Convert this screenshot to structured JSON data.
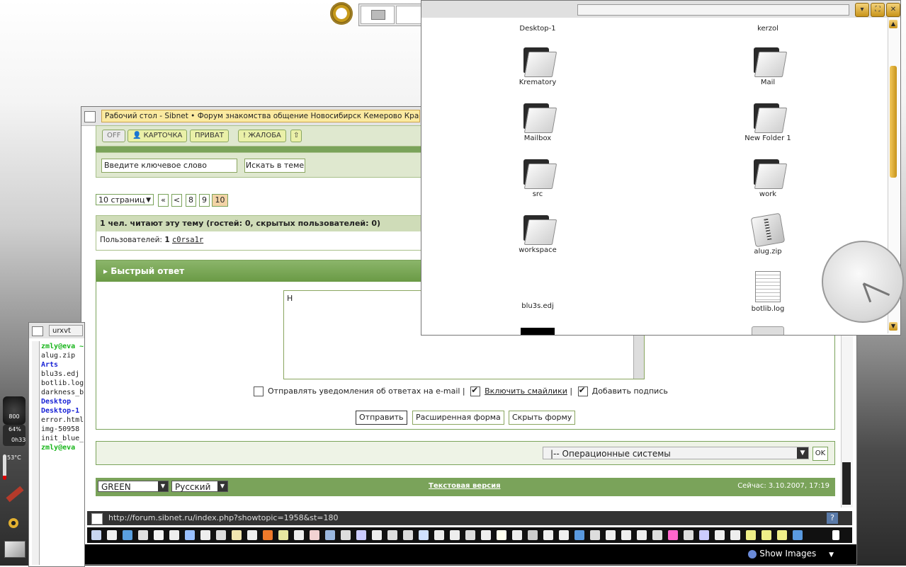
{
  "browser": {
    "title": "Рабочий стол - Sibnet • Форум знакомства общение Новосибирск Кемерово Красноярск",
    "url": "http://forum.sibnet.ru/index.php?showtopic=1958&st=180",
    "status": {
      "show_images": "Show Images"
    }
  },
  "forum": {
    "top_actions": {
      "off": "OFF",
      "card": "КАРТОЧКА",
      "private": "ПРИВАТ",
      "complaint": "ЖАЛОБА"
    },
    "search": {
      "placeholder": "Введите ключевое слово",
      "button": "Искать в теме"
    },
    "pagination": {
      "pages_label": "10 страниц",
      "first": "«",
      "prev": "<",
      "p8": "8",
      "p9": "9",
      "current": "10"
    },
    "readers": {
      "summary": "1 чел. читают эту тему (гостей: 0, скрытых пользователей: 0)",
      "users_prefix": "Пользователей:",
      "users_count": "1",
      "user_name": "c0rsa1r"
    },
    "quick_reply": {
      "title": "Быстрый ответ",
      "text_value": "Н",
      "notify_label": "Отправлять уведомления об ответах на e-mail |",
      "smilies_label": "Включить смайлики",
      "smilies_sep": "|",
      "signature_label": "Добавить подпись",
      "notify_checked": false,
      "smilies_checked": true,
      "signature_checked": true,
      "send": "Отправить",
      "advanced": "Расширенная форма",
      "hide": "Скрыть форму"
    },
    "jump": {
      "selected": "|-- Операционные системы",
      "ok": "OK"
    },
    "footer": {
      "skin": "GREEN",
      "language": "Русский",
      "text_version": "Текстовая версия",
      "now": "Сейчас: 3.10.2007, 17:19"
    }
  },
  "file_manager": {
    "items": [
      {
        "name": "Desktop-1",
        "type": "folder"
      },
      {
        "name": "kerzol",
        "type": "folder"
      },
      {
        "name": "Krematory",
        "type": "folder"
      },
      {
        "name": "Mail",
        "type": "folder"
      },
      {
        "name": "Mailbox",
        "type": "folder"
      },
      {
        "name": "New Folder 1",
        "type": "folder"
      },
      {
        "name": "src",
        "type": "folder"
      },
      {
        "name": "work",
        "type": "folder"
      },
      {
        "name": "workspace",
        "type": "folder"
      },
      {
        "name": "alug.zip",
        "type": "zip"
      },
      {
        "name": "blu3s.edj",
        "type": "file"
      },
      {
        "name": "botlib.log",
        "type": "log"
      }
    ]
  },
  "terminal": {
    "title": "urxvt",
    "lines": [
      {
        "text": "zmly@eva ~",
        "style": "green"
      },
      {
        "text": "alug.zip",
        "style": "plain"
      },
      {
        "text": "Arts",
        "style": "blue"
      },
      {
        "text": "blu3s.edj",
        "style": "plain"
      },
      {
        "text": "botlib.log",
        "style": "plain"
      },
      {
        "text": "darkness_b",
        "style": "plain"
      },
      {
        "text": "Desktop",
        "style": "blue"
      },
      {
        "text": "Desktop-1",
        "style": "blue"
      },
      {
        "text": "error.html",
        "style": "plain"
      },
      {
        "text": "img-50958",
        "style": "plain"
      },
      {
        "text": "init_blue_",
        "style": "plain"
      },
      {
        "text": "zmly@eva",
        "style": "green"
      }
    ]
  },
  "dock": {
    "cpu_value": "800",
    "battery_percent": "64%",
    "battery_time": "0h33",
    "temperature": "53°C"
  },
  "clock": {
    "hour": 5,
    "minute": 19
  },
  "colors": {
    "forum_green": "#7aa35a",
    "current_page": "#f3d3a6",
    "accent_gold": "#c8941a"
  }
}
